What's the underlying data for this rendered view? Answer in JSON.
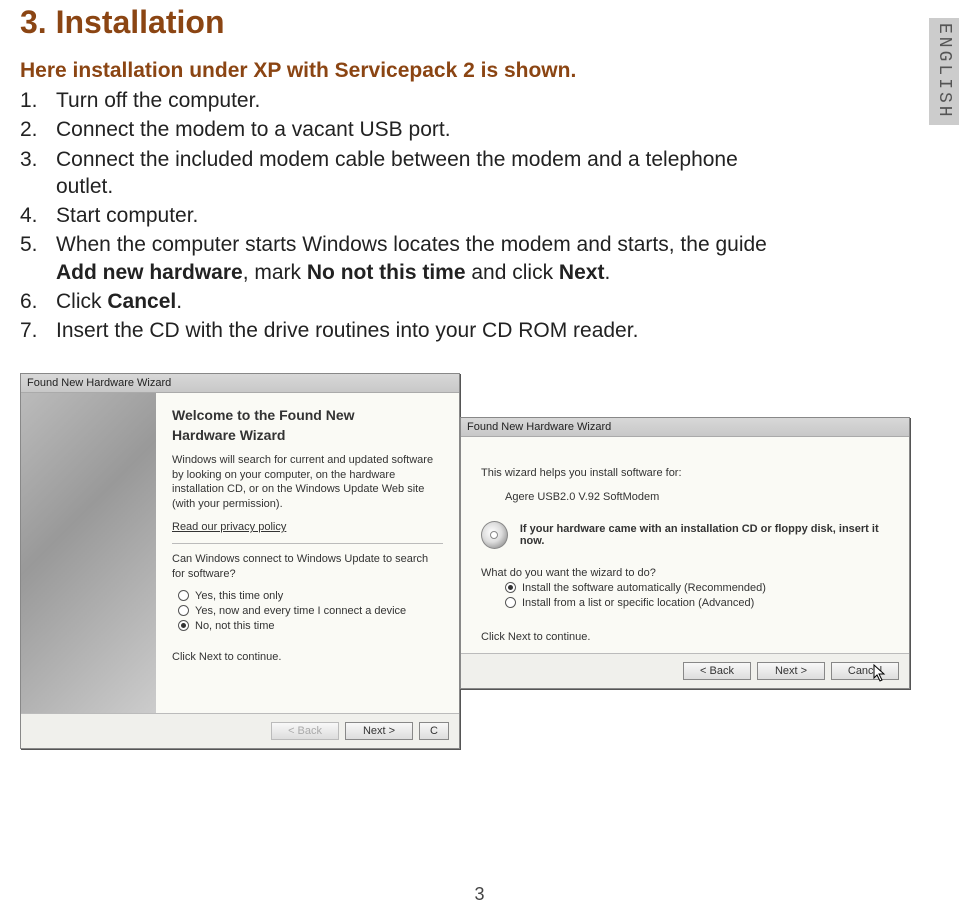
{
  "lang_tab": "ENGLISH",
  "heading": "3. Installation",
  "intro": "Here installation under XP with Servicepack 2 is shown.",
  "steps": [
    {
      "num": "1.",
      "text": "Turn off the computer."
    },
    {
      "num": "2.",
      "text": "Connect the modem to a vacant USB port."
    },
    {
      "num": "3.",
      "text": "Connect the included modem cable between the modem and a telephone outlet."
    },
    {
      "num": "4.",
      "text": "Start computer."
    },
    {
      "num": "5.",
      "text_pre": "When the computer starts Windows locates the modem and starts, the guide ",
      "b1": "Add new hardware",
      "mid1": ", mark ",
      "b2": "No not this time",
      "mid2": " and click ",
      "b3": "Next",
      "tail": "."
    },
    {
      "num": "6.",
      "text_pre": "Click ",
      "b1": "Cancel",
      "tail": "."
    },
    {
      "num": "7.",
      "text": "Insert the CD with the drive routines into your CD ROM reader."
    }
  ],
  "dlg1": {
    "title": "Found New Hardware Wizard",
    "h2a": "Welcome to the Found New",
    "h2b": "Hardware Wizard",
    "p1": "Windows will search for current and updated software by looking on your computer, on the hardware installation CD, or on the Windows Update Web site (with your permission).",
    "link": "Read our privacy policy",
    "q": "Can Windows connect to Windows Update to search for software?",
    "opt1": "Yes, this time only",
    "opt2": "Yes, now and every time I connect a device",
    "opt3": "No, not this time",
    "hint": "Click Next to continue.",
    "back": "< Back",
    "next": "Next >",
    "cancel_cut": "C"
  },
  "dlg2": {
    "title": "Found New Hardware Wizard",
    "p1": "This wizard helps you install software for:",
    "device": "Agere USB2.0 V.92 SoftModem",
    "cd_text": "If your hardware came with an installation CD or floppy disk, insert it now.",
    "q": "What do you want the wizard to do?",
    "opt1": "Install the software automatically (Recommended)",
    "opt2": "Install from a list or specific location (Advanced)",
    "hint": "Click Next to continue.",
    "back": "< Back",
    "next": "Next >",
    "cancel": "Cancel"
  },
  "page_number": "3"
}
